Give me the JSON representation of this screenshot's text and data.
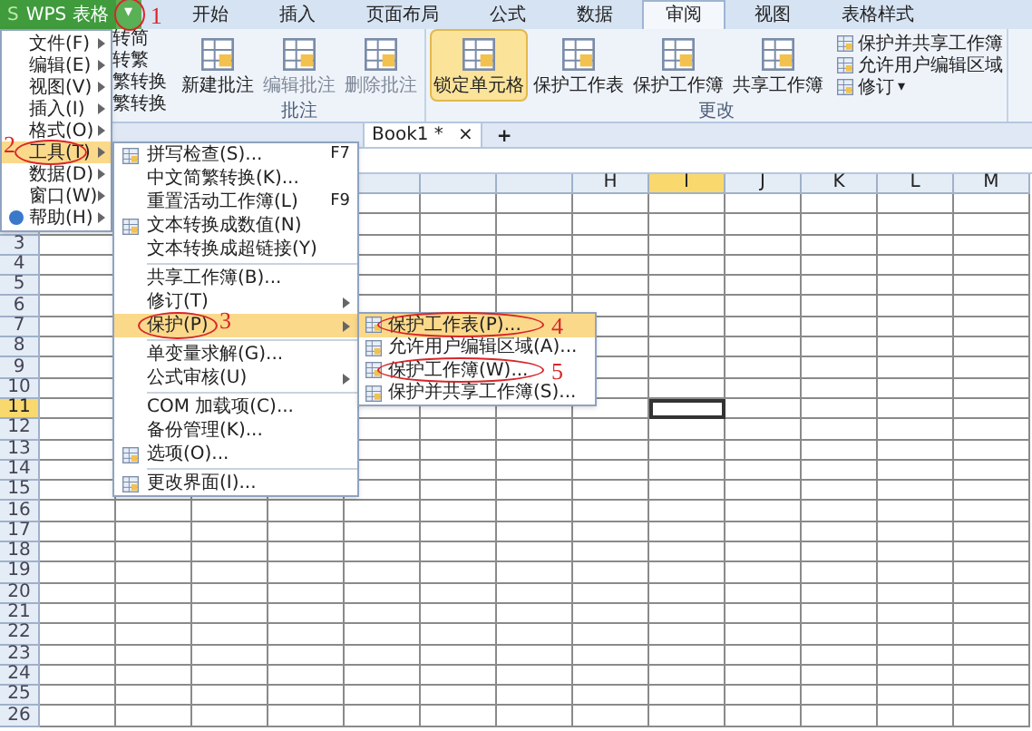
{
  "app_button": {
    "logo": "S",
    "label": "WPS 表格"
  },
  "menu_button": {
    "icon_char": "▾",
    "circled": true,
    "mark": "1"
  },
  "tabs": [
    {
      "label": "开始",
      "selected": false
    },
    {
      "label": "插入",
      "selected": false
    },
    {
      "label": "页面布局",
      "selected": false
    },
    {
      "label": "公式",
      "selected": false
    },
    {
      "label": "数据",
      "selected": false
    },
    {
      "label": "审阅",
      "selected": true
    },
    {
      "label": "视图",
      "selected": false
    },
    {
      "label": "表格样式",
      "selected": false
    }
  ],
  "ribbon": {
    "partial_items": [
      "转简",
      "转繁",
      "繁转换",
      "繁转换"
    ],
    "groups": [
      {
        "label": "批注",
        "buttons": [
          {
            "label": "新建批注",
            "disabled": false,
            "selected": false
          },
          {
            "label": "编辑批注",
            "disabled": true,
            "selected": false
          },
          {
            "label": "删除批注",
            "disabled": true,
            "selected": false
          }
        ]
      },
      {
        "label": "更改",
        "buttons": [
          {
            "label": "锁定单元格",
            "disabled": false,
            "selected": true
          },
          {
            "label": "保护工作表",
            "disabled": false,
            "selected": false
          },
          {
            "label": "保护工作簿",
            "disabled": false,
            "selected": false
          },
          {
            "label": "共享工作簿",
            "disabled": false,
            "selected": false
          }
        ],
        "small_buttons": [
          {
            "label": "保护并共享工作簿"
          },
          {
            "label": "允许用户编辑区域"
          },
          {
            "label": "修订",
            "caret": "▾"
          }
        ]
      }
    ]
  },
  "sheet_tabs": [
    {
      "label": "Book1 *",
      "selected": true,
      "close": "×"
    }
  ],
  "add_sheet": "+",
  "grid": {
    "columns": [
      {
        "label": "H",
        "selected": false
      },
      {
        "label": "I",
        "selected": true
      },
      {
        "label": "J",
        "selected": false
      },
      {
        "label": "K",
        "selected": false
      },
      {
        "label": "L",
        "selected": false
      },
      {
        "label": "M",
        "selected": false
      }
    ],
    "rows": [
      {
        "label": "3",
        "selected": false
      },
      {
        "label": "4",
        "selected": false
      },
      {
        "label": "5",
        "selected": false
      },
      {
        "label": "6",
        "selected": false
      },
      {
        "label": "7",
        "selected": false
      },
      {
        "label": "8",
        "selected": false
      },
      {
        "label": "9",
        "selected": false
      },
      {
        "label": "10",
        "selected": false
      },
      {
        "label": "11",
        "selected": true
      },
      {
        "label": "12",
        "selected": false
      },
      {
        "label": "13",
        "selected": false
      },
      {
        "label": "14",
        "selected": false
      },
      {
        "label": "15",
        "selected": false
      },
      {
        "label": "16",
        "selected": false
      },
      {
        "label": "17",
        "selected": false
      },
      {
        "label": "18",
        "selected": false
      },
      {
        "label": "19",
        "selected": false
      },
      {
        "label": "20",
        "selected": false
      },
      {
        "label": "21",
        "selected": false
      },
      {
        "label": "22",
        "selected": false
      },
      {
        "label": "23",
        "selected": false
      },
      {
        "label": "24",
        "selected": false
      },
      {
        "label": "25",
        "selected": false
      },
      {
        "label": "26",
        "selected": false
      }
    ]
  },
  "main_menu": [
    {
      "label": "文件(F)",
      "selected": false,
      "has_icon": false,
      "circled": false
    },
    {
      "label": "编辑(E)",
      "selected": false,
      "has_icon": false,
      "circled": false
    },
    {
      "label": "视图(V)",
      "selected": false,
      "has_icon": false,
      "circled": false
    },
    {
      "label": "插入(I)",
      "selected": false,
      "has_icon": false,
      "circled": false
    },
    {
      "label": "格式(O)",
      "selected": false,
      "has_icon": false,
      "circled": false
    },
    {
      "label": "工具(T)",
      "selected": true,
      "has_icon": false,
      "circled": true,
      "mark": "2"
    },
    {
      "label": "数据(D)",
      "selected": false,
      "has_icon": false,
      "circled": false
    },
    {
      "label": "窗口(W)",
      "selected": false,
      "has_icon": false,
      "circled": false
    },
    {
      "label": "帮助(H)",
      "selected": false,
      "has_icon": true,
      "circled": false
    }
  ],
  "tools_menu": [
    {
      "kind": "item",
      "label": "拼写检查(S)...",
      "shortcut": "F7",
      "submenu": false,
      "selected": false,
      "has_icon": true,
      "circled": false
    },
    {
      "kind": "item",
      "label": "中文简繁转换(K)...",
      "submenu": false,
      "selected": false,
      "has_icon": false,
      "circled": false
    },
    {
      "kind": "item",
      "label": "重置活动工作簿(L)",
      "shortcut": "F9",
      "submenu": false,
      "selected": false,
      "has_icon": false,
      "circled": false
    },
    {
      "kind": "item",
      "label": "文本转换成数值(N)",
      "submenu": false,
      "selected": false,
      "has_icon": true,
      "circled": false
    },
    {
      "kind": "item",
      "label": "文本转换成超链接(Y)",
      "submenu": false,
      "selected": false,
      "has_icon": false,
      "circled": false
    },
    {
      "kind": "separator"
    },
    {
      "kind": "item",
      "label": "共享工作簿(B)...",
      "submenu": false,
      "selected": false,
      "has_icon": false,
      "circled": false
    },
    {
      "kind": "item",
      "label": "修订(T)",
      "submenu": true,
      "selected": false,
      "has_icon": false,
      "circled": false
    },
    {
      "kind": "item",
      "label": "保护(P)",
      "submenu": true,
      "selected": true,
      "has_icon": false,
      "circled": true,
      "mark": "3"
    },
    {
      "kind": "separator"
    },
    {
      "kind": "item",
      "label": "单变量求解(G)...",
      "submenu": false,
      "selected": false,
      "has_icon": false,
      "circled": false
    },
    {
      "kind": "item",
      "label": "公式审核(U)",
      "submenu": true,
      "selected": false,
      "has_icon": false,
      "circled": false
    },
    {
      "kind": "separator"
    },
    {
      "kind": "item",
      "label": "COM 加载项(C)...",
      "submenu": false,
      "selected": false,
      "has_icon": false,
      "circled": false
    },
    {
      "kind": "item",
      "label": "备份管理(K)...",
      "submenu": false,
      "selected": false,
      "has_icon": false,
      "circled": false
    },
    {
      "kind": "item",
      "label": "选项(O)...",
      "submenu": false,
      "selected": false,
      "has_icon": true,
      "circled": false
    },
    {
      "kind": "separator"
    },
    {
      "kind": "item",
      "label": "更改界面(I)...",
      "submenu": false,
      "selected": false,
      "has_icon": true,
      "circled": false
    }
  ],
  "protect_menu": [
    {
      "label": "保护工作表(P)...",
      "selected": true,
      "circled": true,
      "mark": "4"
    },
    {
      "label": "允许用户编辑区域(A)...",
      "selected": false,
      "circled": false
    },
    {
      "label": "保护工作簿(W)...",
      "selected": false,
      "circled": true,
      "mark": "5"
    },
    {
      "label": "保护并共享工作簿(S)...",
      "selected": false,
      "circled": false
    }
  ]
}
